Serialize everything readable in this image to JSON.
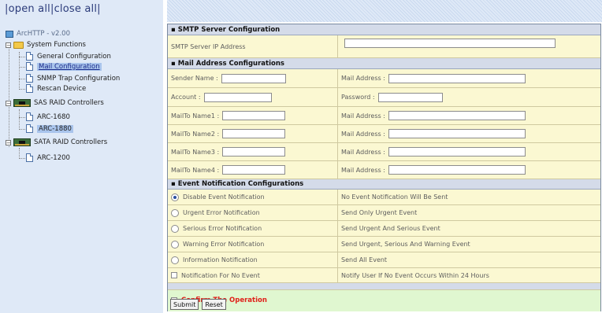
{
  "topbar": {
    "open_all": "open all",
    "sep": "|",
    "close_all": "close all"
  },
  "tree": {
    "root": "ArcHTTP - v2.00",
    "system_functions": "System Functions",
    "general_config": "General Configuration",
    "mail_config": "Mail Configuration",
    "snmp_config": "SNMP Trap Configuration",
    "rescan": "Rescan Device",
    "sas_group": "SAS RAID Controllers",
    "arc1680": "ARC-1680",
    "arc1880": "ARC-1880",
    "sata_group": "SATA RAID Controllers",
    "arc1200": "ARC-1200"
  },
  "smtp": {
    "header": "SMTP Server Configuration",
    "ip_label": "SMTP Server IP Address",
    "ip_value": ""
  },
  "mail": {
    "header": "Mail Address Configurations",
    "sender_label": "Sender Name :",
    "sender_value": "",
    "mail_address_label": "Mail Address :",
    "account_label": "Account :",
    "password_label": "Password :",
    "mailto": [
      {
        "label": "MailTo Name1 :",
        "addr_label": "Mail Address :"
      },
      {
        "label": "MailTo Name2 :",
        "addr_label": "Mail Address :"
      },
      {
        "label": "MailTo Name3 :",
        "addr_label": "Mail Address :"
      },
      {
        "label": "MailTo Name4 :",
        "addr_label": "Mail Address :"
      }
    ]
  },
  "event": {
    "header": "Event Notification Configurations",
    "options": [
      {
        "label": "Disable Event Notification",
        "desc": "No Event Notification Will Be Sent",
        "checked": true
      },
      {
        "label": "Urgent Error Notification",
        "desc": "Send Only Urgent Event",
        "checked": false
      },
      {
        "label": "Serious Error Notification",
        "desc": "Send Urgent And Serious Event",
        "checked": false
      },
      {
        "label": "Warning Error Notification",
        "desc": "Send Urgent, Serious And Warning Event",
        "checked": false
      },
      {
        "label": "Information Notification",
        "desc": "Send All Event",
        "checked": false
      }
    ],
    "no_event_label": "Notification For No Event",
    "no_event_desc": "Notify User If No Event Occurs Within 24 Hours"
  },
  "confirm": {
    "label": "Confirm The Operation",
    "color": "#e0201a"
  },
  "buttons": {
    "submit": "Submit",
    "reset": "Reset"
  }
}
